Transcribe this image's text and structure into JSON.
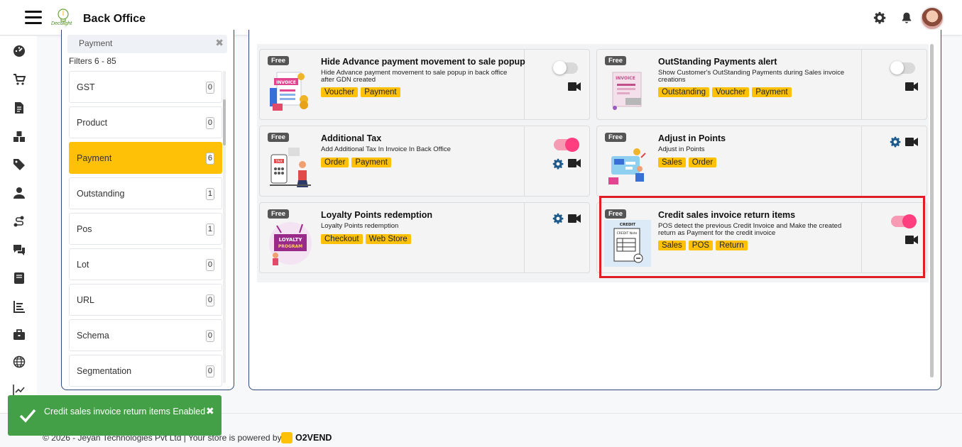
{
  "header": {
    "app_title": "Back Office",
    "logo_text": "Decolight"
  },
  "filter": {
    "search_value": "Payment",
    "clear_glyph": "✖",
    "count_label": "Filters 6 - 85",
    "items": [
      {
        "label": "GST",
        "count": "0"
      },
      {
        "label": "Product",
        "count": "0"
      },
      {
        "label": "Payment",
        "count": "6",
        "active": true
      },
      {
        "label": "Outstanding",
        "count": "1"
      },
      {
        "label": "Pos",
        "count": "1"
      },
      {
        "label": "Lot",
        "count": "0"
      },
      {
        "label": "URL",
        "count": "0"
      },
      {
        "label": "Schema",
        "count": "0"
      },
      {
        "label": "Segmentation",
        "count": "0"
      }
    ]
  },
  "cards": [
    {
      "badge": "Free",
      "title": "Hide Advance payment movement to sale popup",
      "desc": "Hide Advance payment movement to sale popup in back office after GDN created",
      "tags": [
        "Voucher",
        "Payment"
      ],
      "toggle": "off",
      "settings": false
    },
    {
      "badge": "Free",
      "title": "OutStanding Payments alert",
      "desc": "Show Customer's OutStanding Payments during Sales invoice creations",
      "tags": [
        "Outstanding",
        "Voucher",
        "Payment"
      ],
      "toggle": "off",
      "settings": false
    },
    {
      "badge": "Free",
      "title": "Additional Tax",
      "desc": "Add Additional Tax In Invoice In Back Office",
      "tags": [
        "Order",
        "Payment"
      ],
      "toggle": "on",
      "settings": true
    },
    {
      "badge": "Free",
      "title": "Adjust in Points",
      "desc": "Adjust in Points",
      "tags": [
        "Sales",
        "Order"
      ],
      "toggle": "none",
      "settings": true
    },
    {
      "badge": "Free",
      "title": "Loyalty Points redemption",
      "desc": "Loyalty Points redemption",
      "tags": [
        "Checkout",
        "Web Store"
      ],
      "toggle": "none",
      "settings": true
    },
    {
      "badge": "Free",
      "title": "Credit sales invoice return items",
      "desc": "POS detect the previous Credit Invoice and Make the created return as Payment for the credit invoice",
      "tags": [
        "Sales",
        "POS",
        "Return"
      ],
      "toggle": "on",
      "settings": false
    }
  ],
  "toast": {
    "message": "Credit sales invoice return items Enabled",
    "close_glyph": "✖"
  },
  "footer": {
    "copyright": "© 2026 - Jeyan Technologies Pvt Ltd | Your store is powered by",
    "brand": "O2VEND"
  },
  "colors": {
    "accent": "#ffc107",
    "toggle_on": "#ff3e80",
    "toast": "#43a047",
    "highlight": "#e01e26",
    "panel_border": "#2d4a78"
  },
  "thumbs": {
    "invoice_text": "INVOICE",
    "tax_text": "TAX",
    "loyalty_text_1": "LOYALTY",
    "loyalty_text_2": "PROGRAM",
    "credit_text": "CREDIT",
    "credit_note_text": "CREDIT Note"
  }
}
